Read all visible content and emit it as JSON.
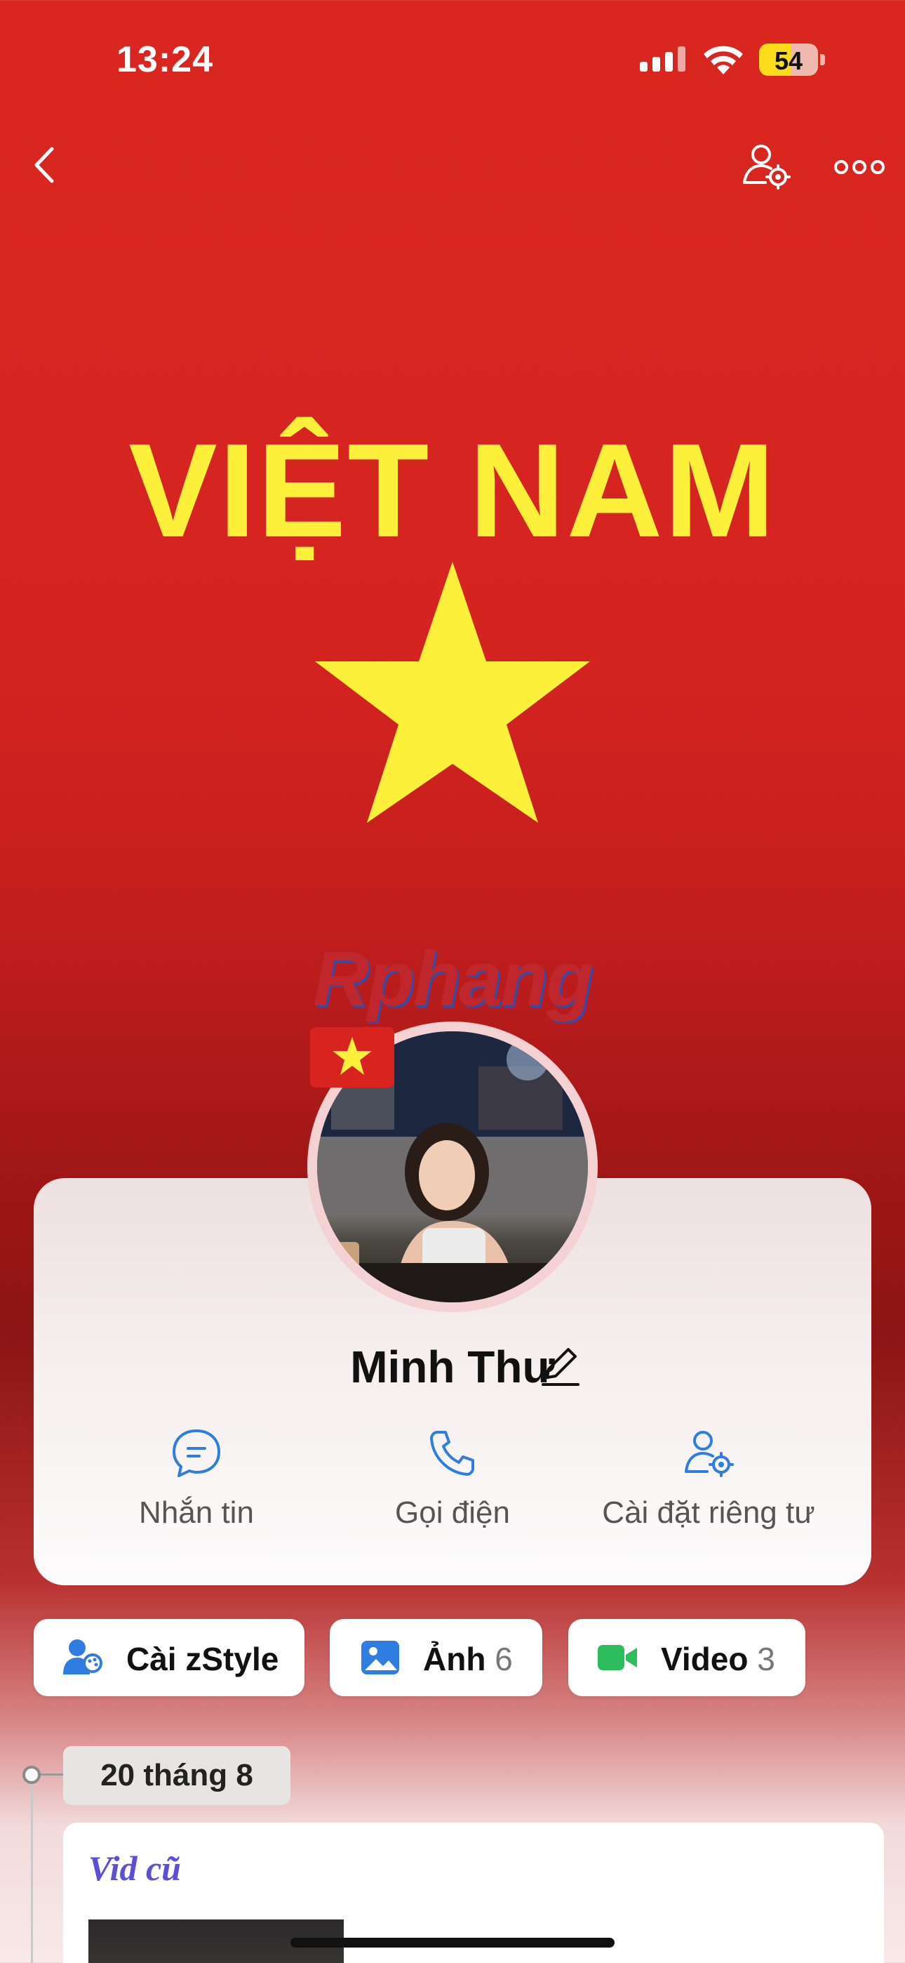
{
  "status_bar": {
    "time": "13:24",
    "battery_level": "54",
    "battery_fraction": 0.54,
    "signal_icon": "cellular-signal-icon",
    "wifi_icon": "wifi-icon"
  },
  "nav": {
    "back_icon": "chevron-left-icon",
    "settings_icon": "user-settings-icon",
    "more_icon": "more-horizontal-icon"
  },
  "cover": {
    "title": "VIỆT NAM",
    "watermark": "Rphang",
    "star_icon": "star-icon",
    "colors": {
      "background": "#d9261f",
      "accent": "#fdf03a"
    }
  },
  "profile": {
    "name": "Minh Thư",
    "flag_icon": "vietnam-flag-icon",
    "edit_icon": "pencil-icon",
    "actions": [
      {
        "label": "Nhắn tin",
        "icon": "message-icon"
      },
      {
        "label": "Gọi điện",
        "icon": "phone-icon"
      },
      {
        "label": "Cài đặt riêng tư",
        "icon": "user-settings-icon"
      }
    ]
  },
  "chips": {
    "zstyle": {
      "label": "Cài zStyle",
      "icon": "zstyle-icon"
    },
    "photos": {
      "label": "Ảnh",
      "count": "6",
      "icon": "image-icon"
    },
    "videos": {
      "label": "Video",
      "count": "3",
      "icon": "video-camera-icon"
    }
  },
  "timeline": {
    "date": "20 tháng 8",
    "post_title": "Vid cũ"
  }
}
